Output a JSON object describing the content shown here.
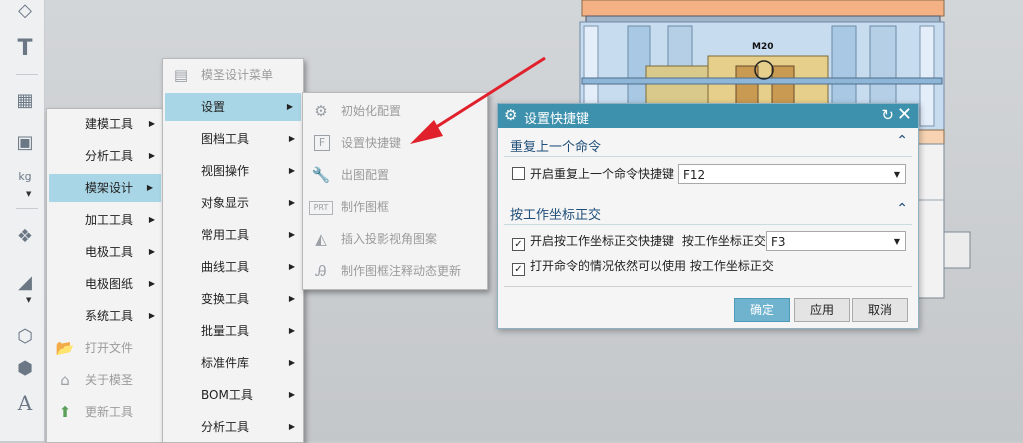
{
  "main_menu": {
    "items": [
      {
        "label": "建模工具"
      },
      {
        "label": "分析工具"
      },
      {
        "label": "模架设计"
      },
      {
        "label": "加工工具"
      },
      {
        "label": "电极工具"
      },
      {
        "label": "电极图纸"
      },
      {
        "label": "系统工具"
      },
      {
        "label": "打开文件"
      },
      {
        "label": "关于模圣"
      },
      {
        "label": "更新工具"
      }
    ]
  },
  "sub_menu": {
    "header": "模圣设计菜单",
    "items": [
      {
        "label": "设置"
      },
      {
        "label": "图档工具"
      },
      {
        "label": "视图操作"
      },
      {
        "label": "对象显示"
      },
      {
        "label": "常用工具"
      },
      {
        "label": "曲线工具"
      },
      {
        "label": "变换工具"
      },
      {
        "label": "批量工具"
      },
      {
        "label": "标准件库"
      },
      {
        "label": "BOM工具"
      },
      {
        "label": "分析工具"
      }
    ]
  },
  "settings_menu": {
    "items": [
      {
        "label": "初始化配置",
        "icon": "gear-icon"
      },
      {
        "label": "设置快捷键",
        "icon": "f-key-icon"
      },
      {
        "label": "出图配置",
        "icon": "wrench-icon"
      },
      {
        "label": "制作图框",
        "icon": "prt-icon"
      },
      {
        "label": "插入投影视角图案",
        "icon": "projection-icon"
      },
      {
        "label": "制作图框注释动态更新",
        "icon": "annotation-icon"
      }
    ]
  },
  "dialog": {
    "title": "设置快捷键",
    "section1": {
      "title": "重复上一个命令",
      "checkbox_label": "开启重复上一个命令快捷键",
      "checked": false,
      "select_value": "F12"
    },
    "section2": {
      "title": "按工作坐标正交",
      "checkbox1_label": "开启按工作坐标正交快捷键",
      "inline_label": "按工作坐标正交",
      "select_value": "F3",
      "checkbox2_label": "打开命令的情况依然可以使用 按工作坐标正交"
    },
    "buttons": {
      "ok": "确定",
      "apply": "应用",
      "cancel": "取消"
    }
  },
  "model": {
    "label": "M20"
  },
  "colors": {
    "title_bar": "#3e91ad",
    "active_item": "#a9d6e6",
    "arrow": "#e0202a"
  }
}
